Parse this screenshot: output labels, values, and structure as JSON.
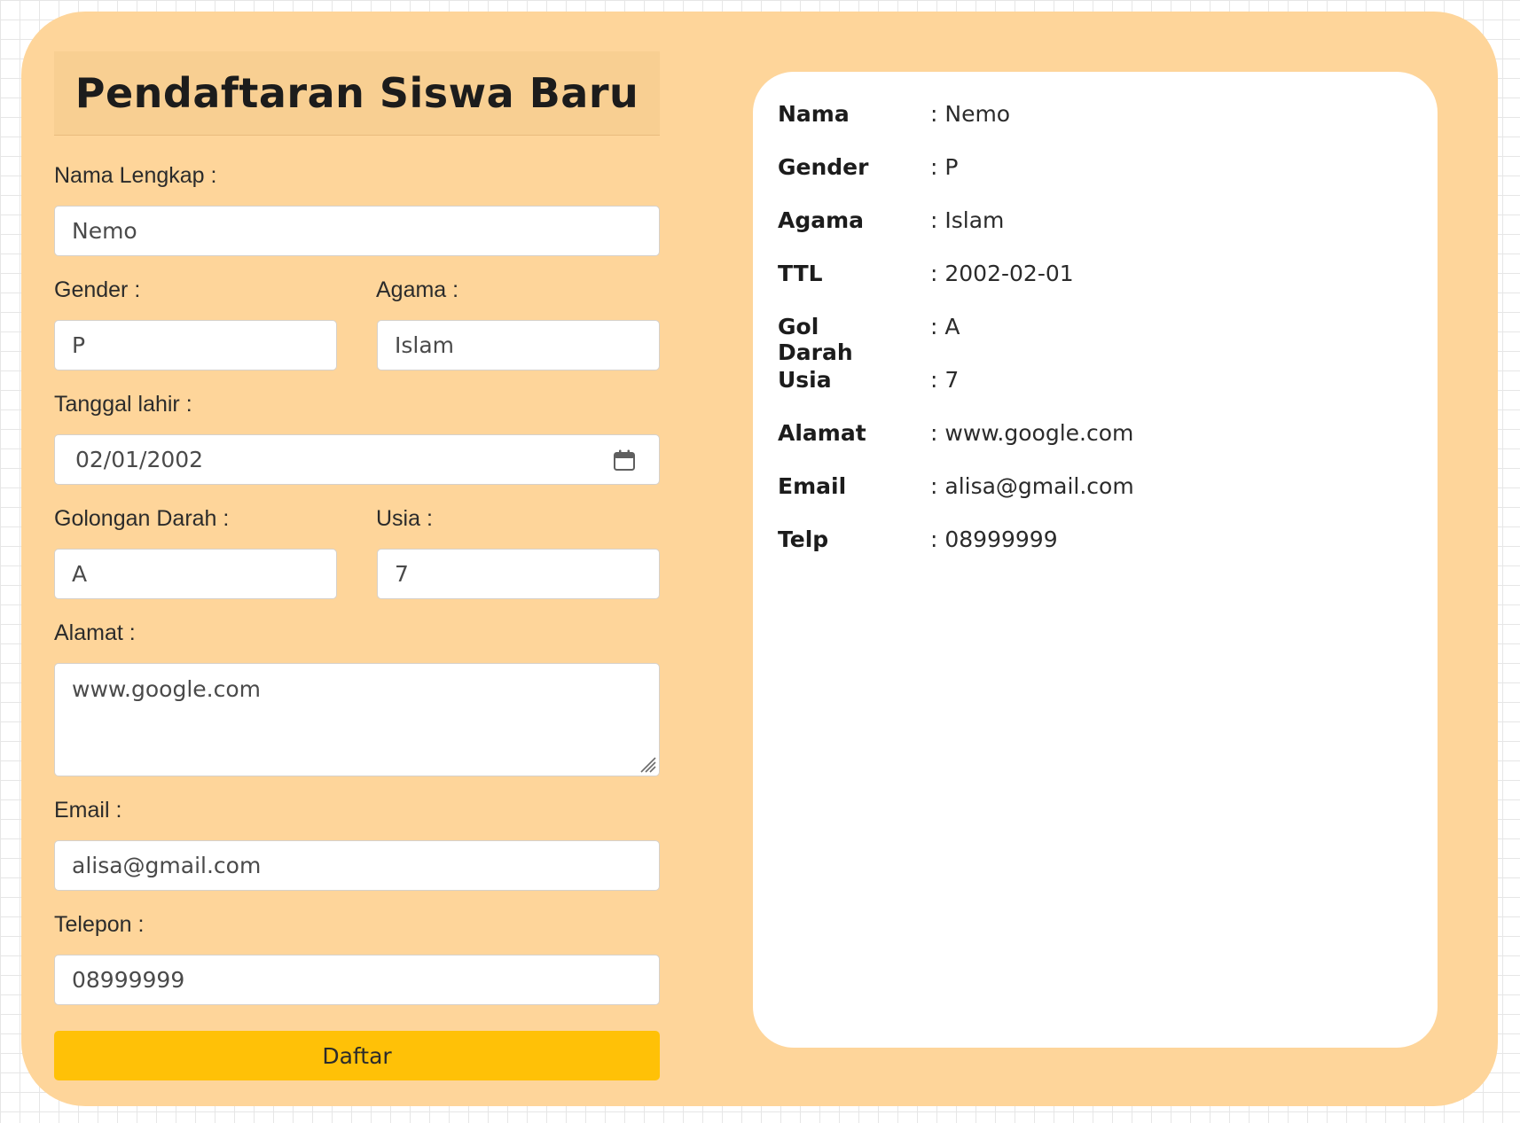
{
  "form": {
    "title": "Pendaftaran Siswa Baru",
    "fields": {
      "nama": {
        "label": "Nama Lengkap :",
        "value": "Nemo"
      },
      "gender": {
        "label": "Gender :",
        "value": "P"
      },
      "agama": {
        "label": "Agama :",
        "value": "Islam"
      },
      "tanggal": {
        "label": "Tanggal lahir :",
        "value": "02/01/2002"
      },
      "goldarah": {
        "label": "Golongan Darah :",
        "value": "A"
      },
      "usia": {
        "label": "Usia :",
        "value": "7"
      },
      "alamat": {
        "label": "Alamat :",
        "value": "www.google.com"
      },
      "email": {
        "label": "Email :",
        "value": "alisa@gmail.com"
      },
      "telepon": {
        "label": "Telepon :",
        "value": "08999999"
      }
    },
    "submit_label": "Daftar"
  },
  "summary": [
    {
      "key": "Nama",
      "value": ": Nemo"
    },
    {
      "key": "Gender",
      "value": ": P"
    },
    {
      "key": "Agama",
      "value": ": Islam"
    },
    {
      "key": "TTL",
      "value": ": 2002-02-01"
    },
    {
      "key": "Gol Darah",
      "value": ": A"
    },
    {
      "key": "Usia",
      "value": ": 7"
    },
    {
      "key": "Alamat",
      "value": ": www.google.com"
    },
    {
      "key": "Email",
      "value": ": alisa@gmail.com"
    },
    {
      "key": "Telp",
      "value": ": 08999999"
    }
  ],
  "colors": {
    "card_bg": "#fed59a",
    "title_bg": "#f8cf92",
    "button_bg": "#ffc107",
    "panel_bg": "#ffffff"
  },
  "icons": {
    "date": "calendar-icon",
    "textarea": "resize-handle-icon"
  }
}
